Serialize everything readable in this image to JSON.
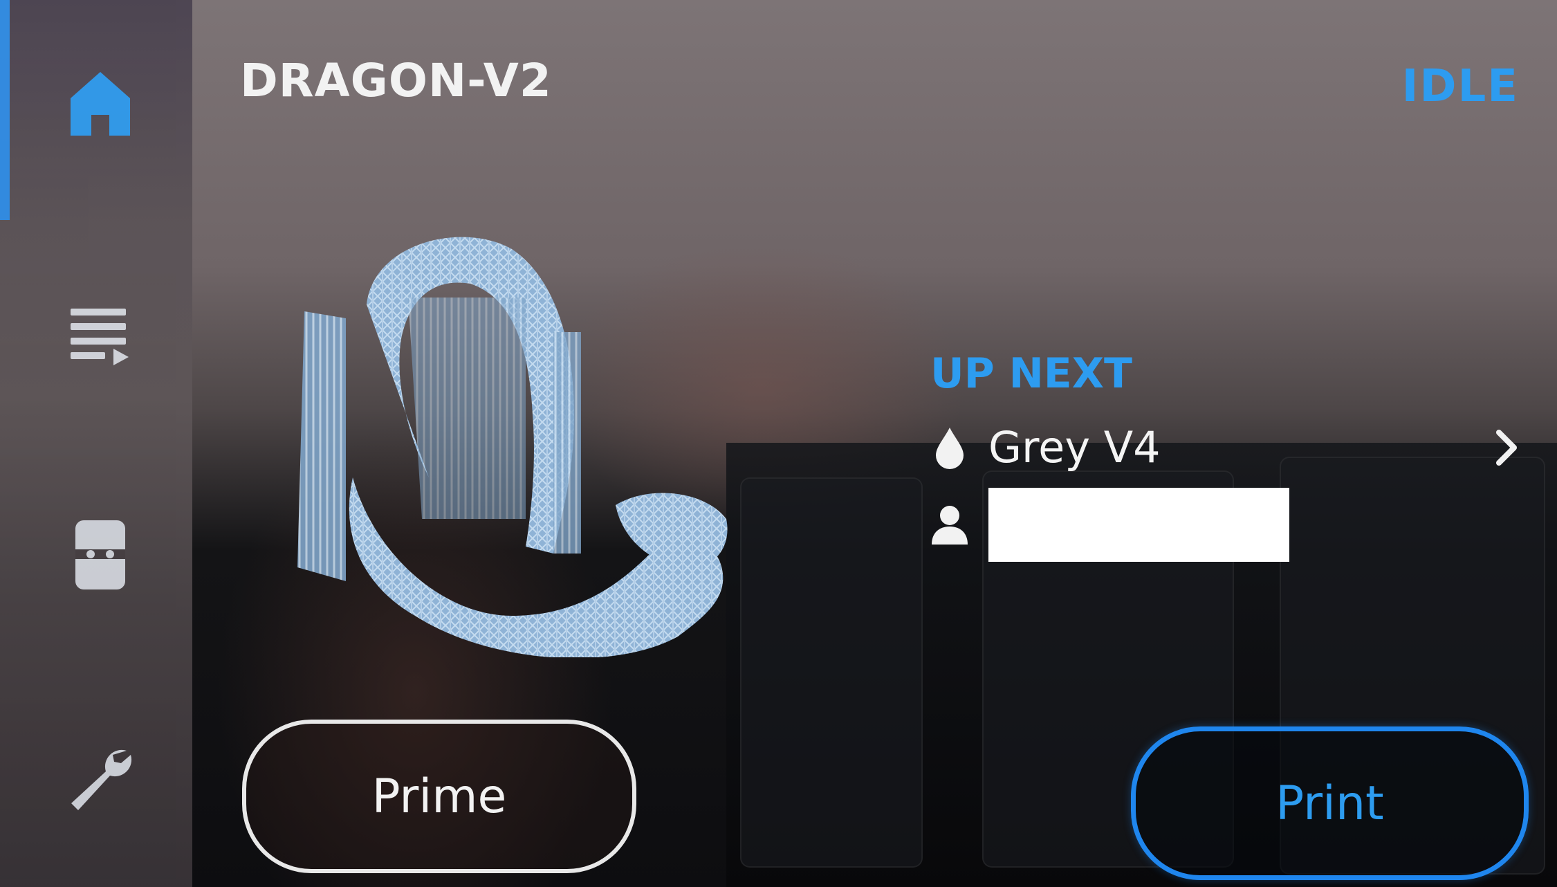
{
  "header": {
    "printer_name": "DRAGON-V2",
    "status": "IDLE"
  },
  "sidebar": {
    "items": [
      {
        "name": "home",
        "icon": "home-icon",
        "active": true
      },
      {
        "name": "queue",
        "icon": "queue-icon",
        "active": false
      },
      {
        "name": "material",
        "icon": "cartridge-icon",
        "active": false
      },
      {
        "name": "settings",
        "icon": "wrench-icon",
        "active": false
      }
    ]
  },
  "up_next": {
    "heading": "UP NEXT",
    "material": "Grey V4",
    "owner": ""
  },
  "actions": {
    "prime_label": "Prime",
    "print_label": "Print"
  },
  "colors": {
    "accent": "#2d9cf0",
    "print_border": "#1f86ee",
    "model": "#a9c8e6"
  }
}
